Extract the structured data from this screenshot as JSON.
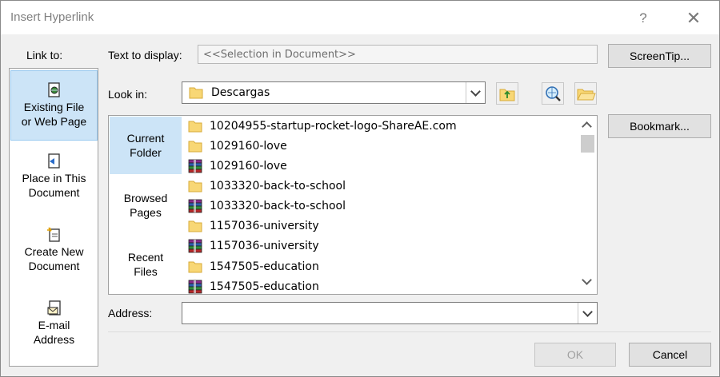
{
  "window": {
    "title": "Insert Hyperlink",
    "help": "?",
    "close": "✕"
  },
  "link_to": {
    "label": "Link to:",
    "items": [
      {
        "line1": "Existing File",
        "line2": "or Web Page",
        "selected": true
      },
      {
        "line1": "Place in This",
        "line2": "Document",
        "selected": false
      },
      {
        "line1": "Create New",
        "line2": "Document",
        "selected": false
      },
      {
        "line1": "E-mail",
        "line2": "Address",
        "selected": false
      }
    ]
  },
  "text_to_display": {
    "label": "Text to display:",
    "value": "<<Selection in Document>>"
  },
  "screentip_label": "ScreenTip...",
  "look_in": {
    "label": "Look in:",
    "value": "Descargas"
  },
  "bookmark_label": "Bookmark...",
  "side_tabs": [
    {
      "line1": "Current",
      "line2": "Folder",
      "selected": true
    },
    {
      "line1": "Browsed",
      "line2": "Pages",
      "selected": false
    },
    {
      "line1": "Recent",
      "line2": "Files",
      "selected": false
    }
  ],
  "files": [
    {
      "name": "10204955-startup-rocket-logo-ShareAE.com",
      "icon": "folder-icon"
    },
    {
      "name": "1029160-love",
      "icon": "folder-icon"
    },
    {
      "name": "1029160-love",
      "icon": "archive-icon"
    },
    {
      "name": "1033320-back-to-school",
      "icon": "folder-icon"
    },
    {
      "name": "1033320-back-to-school",
      "icon": "archive-icon"
    },
    {
      "name": "1157036-university",
      "icon": "folder-icon"
    },
    {
      "name": "1157036-university",
      "icon": "archive-icon"
    },
    {
      "name": "1547505-education",
      "icon": "folder-icon"
    },
    {
      "name": "1547505-education",
      "icon": "archive-icon"
    }
  ],
  "address": {
    "label": "Address:",
    "value": ""
  },
  "ok_label": "OK",
  "cancel_label": "Cancel",
  "colors": {
    "selection": "#cce4f7",
    "folder": "#f8d775",
    "background": "#f0f0f0"
  }
}
